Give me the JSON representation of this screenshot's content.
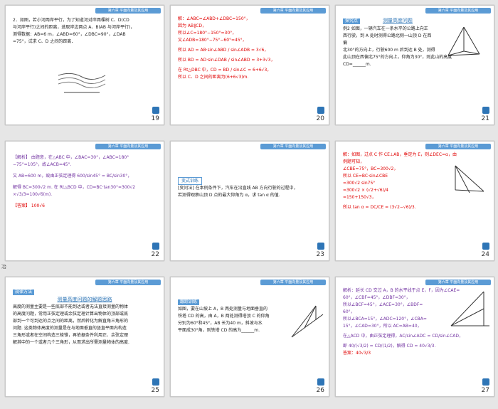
{
  "header_label": "第六章  平面向量及其应用",
  "slides": [
    {
      "num": "19",
      "lines": [
        "2．如图，若小河两岸平行，为了知道河对岸两棵树 C、D(CD",
        "与河岸平行)之间的距离，选取岸边两点 A、B(AB 与河岸平行)，",
        "测得数据：AB=6 m，∠ABD=60°，∠DBC=90°，∠DAB",
        "=75°，试求 C、D 之间的距离．"
      ]
    },
    {
      "num": "20",
      "lines": [
        "解：∠ABC=∠ABD+∠DBC=150°，",
        "因为 AB∥CD，",
        "所以∠C=180°−150°=30°，",
        "又∠ADB=180°−75°−60°=45°，",
        "所以 AD = AB·sin∠ABD / sin∠ADB = 3√6，",
        "所以 BD = AD·sin∠DAB / sin∠ABD = 3+3√3，",
        "在 Rt△DBC 中，CD = BD / sin∠C = 6+6√3，",
        "所以 C、D 之间的距离为(6+6√3)m."
      ]
    },
    {
      "num": "21",
      "lines": [
        "探究点",
        "测量高度问题",
        "例2  如图，一辆汽车在一条水平的公路上向正",
        "西行驶，到 A 处时测得公路北侧一山顶 D 在西偏",
        "北30°的方向上，行驶600 m 后到达 B 处，测得",
        "此山顶在西偏北75°的方向上，仰角为30°，则此山的高度",
        "CD=______m."
      ]
    },
    {
      "num": "22",
      "lines": [
        "【解析】 由题意，在△ABC 中，∠BAC=30°，∠ABC=180°",
        "−75°=105°，故∠ACB=45°.",
        "又 AB=600 m，故由正弦定理得 600/sin45° = BC/sin30°，",
        "解得 BC=300√2 m. 在 Rt△BCD 中，CD=BC·tan30°=300√2",
        "×√3/3=100√6(m).",
        "【答案】  100√6"
      ]
    },
    {
      "num": "23",
      "lines": [
        "变式训练",
        "[变问法] 在本例条件下，汽车在沿直线 AB 方向行驶的过程中，",
        "若测得观察山顶 D 点的最大仰角为 α，求 tan α 的值."
      ]
    },
    {
      "num": "24",
      "lines": [
        "解：如图，过点 C 作 CE⊥AB，垂足为 E，则∠DEC=α，由",
        "例题可知，",
        "∠CBE=75°，BC=300√2，",
        "所以 CE=BC·sin∠CBE",
        "=300√2 sin75°",
        "=300√2 × (√2+√6)/4",
        "=150+150√3，",
        "所以 tan α = DC/CE = (3√2−√6)/3."
      ]
    },
    {
      "num": "25",
      "lines": [
        "规律方法",
        "测量高度问题的解题思路",
        "高度的测量主要是一些底部不能到达或者无法直接测量的物体",
        "的高度问题，常用正弦定理或余弦定理计算出物体的顶部或底",
        "部到一个可到达的点之间的距离，然后转化为解直角三角形的",
        "问题. 这类物体高度的测量是在与地面垂直的竖直平面内构造",
        "三角形或者在空间构造三棱锥，再依据条件利用正、余弦定理",
        "解其中的一个或者几个三角形，从而求出所需测量物体的高度."
      ]
    },
    {
      "num": "26",
      "lines": [
        "跟踪训练",
        "如图，要在山坡上 A，B 两处测量与地面垂直的",
        "铁塔 CD 的高，由 A，B 两处测得塔顶 C 的仰角",
        "分别为60°和45°，AB 长为40 m，斜坡与水",
        "平面成30°角，则铁塔 CD 的高为______m."
      ]
    },
    {
      "num": "27",
      "lines": [
        "解析：延长 CD 交过 A，B 的水平线于点 E，F，因为∠CAE=",
        "60°，∠CBF=45°，∠DBF=30°，",
        "所以∠BCF=45°，∠ACE=30°，∠BDF=",
        "60°，",
        "所以∠BCA=15°，∠ADC=120°，∠CBA=",
        "15°，∠CAD=30°，所以 AC=AB=40，",
        "在△ACD 中，由正弦定理得，AC/sin∠ADC = CD/sin∠CAD，",
        "即 40/(√3/2) = CD/(1/2)，解得 CD = 40√3/3.",
        "答案：40√3/3"
      ]
    }
  ],
  "side_label": "冶"
}
